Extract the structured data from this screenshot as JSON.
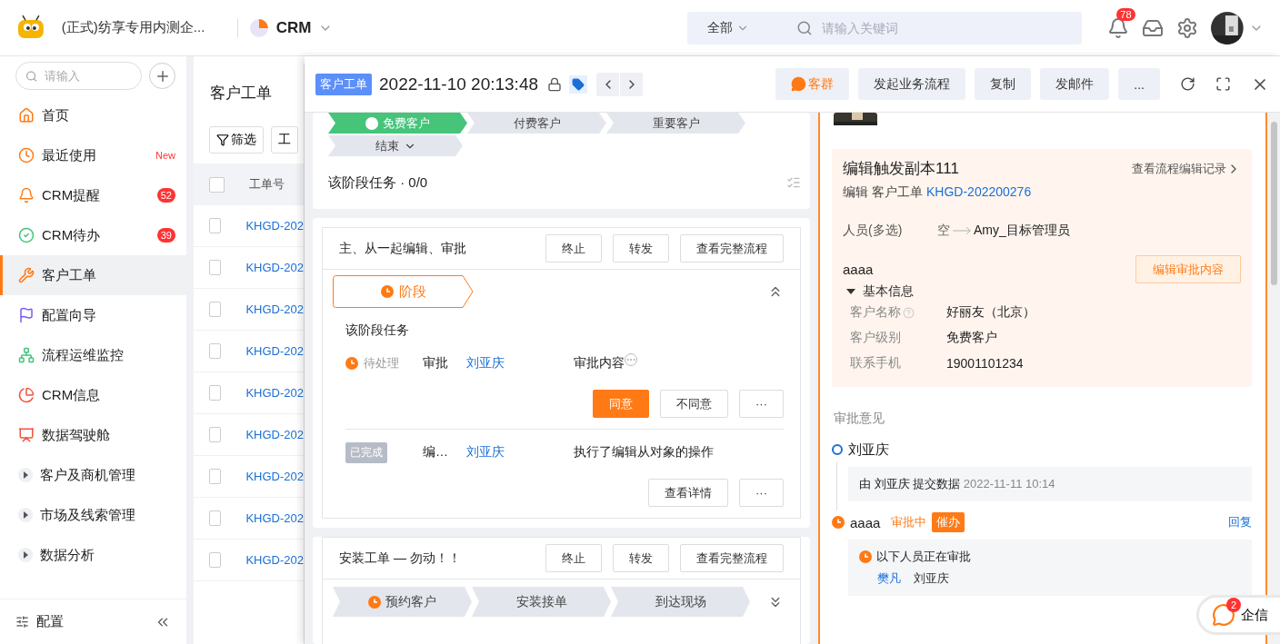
{
  "topbar": {
    "org": "(正式)纺享专用内测企...",
    "app": "CRM",
    "search_scope": "全部",
    "search_placeholder": "请输入关键词",
    "notification_count": "78"
  },
  "sidebar": {
    "search_placeholder": "请输入",
    "items": [
      {
        "label": "首页",
        "kind": "link",
        "selected": false
      },
      {
        "label": "最近使用",
        "kind": "link",
        "selected": false,
        "badge": "New",
        "badge_pill": false
      },
      {
        "label": "CRM提醒",
        "kind": "link",
        "selected": false,
        "badge": "52",
        "badge_pill": true
      },
      {
        "label": "CRM待办",
        "kind": "link",
        "selected": false,
        "badge": "39",
        "badge_pill": true
      },
      {
        "label": "客户工单",
        "kind": "link",
        "selected": true
      },
      {
        "label": "配置向导",
        "kind": "link",
        "selected": false
      },
      {
        "label": "流程运维监控",
        "kind": "link",
        "selected": false
      },
      {
        "label": "CRM信息",
        "kind": "link",
        "selected": false
      },
      {
        "label": "数据驾驶舱",
        "kind": "link",
        "selected": false
      },
      {
        "label": "客户及商机管理",
        "kind": "group",
        "selected": false
      },
      {
        "label": "市场及线索管理",
        "kind": "group",
        "selected": false
      },
      {
        "label": "数据分析",
        "kind": "group",
        "selected": false
      }
    ],
    "footer": "配置"
  },
  "list": {
    "title": "客户工单",
    "filter": "筛选",
    "button_2": "工",
    "column": "工单号",
    "all_checked": false,
    "rows": [
      {
        "number": "KHGD-202",
        "checked": false
      },
      {
        "number": "KHGD-202",
        "checked": false
      },
      {
        "number": "KHGD-202",
        "checked": false
      },
      {
        "number": "KHGD-202",
        "checked": false
      },
      {
        "number": "KHGD-202",
        "checked": false
      },
      {
        "number": "KHGD-202",
        "checked": false
      },
      {
        "number": "KHGD-202",
        "checked": false
      },
      {
        "number": "KHGD-202",
        "checked": false
      },
      {
        "number": "KHGD-202",
        "checked": false
      }
    ]
  },
  "drawer": {
    "tag": "客户工单",
    "title": "2022-11-10 20:13:48",
    "actions": [
      {
        "label": "客群",
        "kind": "chat"
      },
      {
        "label": "发起业务流程",
        "kind": "plain"
      },
      {
        "label": "复制",
        "kind": "plain"
      },
      {
        "label": "发邮件",
        "kind": "plain"
      },
      {
        "label": "...",
        "kind": "plain"
      }
    ]
  },
  "stage_card": {
    "stages": [
      {
        "label": "免费客户",
        "selected": true
      },
      {
        "label": "付费客户",
        "selected": false
      },
      {
        "label": "重要客户",
        "selected": false
      },
      {
        "label": "结束",
        "selected": false,
        "dropdown": true
      }
    ],
    "task_summary": "该阶段任务 · 0/0"
  },
  "approval_flow": {
    "title": "主、从一起编辑、审批",
    "buttons": [
      "终止",
      "转发",
      "查看完整流程"
    ],
    "stage": "阶段",
    "expanded": true,
    "tasks_title": "该阶段任务",
    "tasks": [
      {
        "kind": "pending",
        "status": "待处理",
        "type": "审批",
        "person": "刘亚庆",
        "content": "审批内容",
        "actions": [
          {
            "label": "同意",
            "primary": true
          },
          {
            "label": "不同意",
            "primary": false
          },
          {
            "label": "···",
            "primary": false
          }
        ]
      },
      {
        "kind": "done",
        "status": "已完成",
        "type": "编…",
        "person": "刘亚庆",
        "content": "执行了编辑从对象的操作",
        "actions": [
          {
            "label": "查看详情",
            "primary": false
          },
          {
            "label": "···",
            "primary": false
          }
        ]
      }
    ]
  },
  "install_flow": {
    "title": "安装工单 — 勿动！！",
    "buttons": [
      "终止",
      "转发",
      "查看完整流程"
    ],
    "expanded": false,
    "stages": [
      {
        "label": "预约客户",
        "selected": true
      },
      {
        "label": "安装接单",
        "selected": false
      },
      {
        "label": "到达现场",
        "selected": false
      }
    ]
  },
  "record": {
    "title": "编辑触发副本111",
    "history_link": "查看流程编辑记录",
    "verb": "编辑",
    "object": "客户工单",
    "object_link": "KHGD-202200276",
    "change": {
      "field": "人员(多选)",
      "from": "空",
      "to": "Amy_目标管理员"
    },
    "form_title": "aaaa",
    "edit_button": "编辑审批内容",
    "section": "基本信息",
    "section_expanded": true,
    "fields": [
      {
        "label": "客户名称",
        "value": "好丽友（北京）",
        "help": true
      },
      {
        "label": "客户级别",
        "value": "免费客户",
        "help": false
      },
      {
        "label": "联系手机",
        "value": "19001101234",
        "help": false
      }
    ]
  },
  "opinions": {
    "heading": "审批意见",
    "nodes": [
      {
        "kind": "submitted",
        "name": "刘亚庆",
        "by": "由 刘亚庆 提交数据",
        "time": "2022-11-11 10:14"
      },
      {
        "kind": "in_progress",
        "name": "aaaa",
        "status": "审批中",
        "urge": "催办",
        "reply": "回复",
        "pending_label": "以下人员正在审批",
        "approvers": [
          {
            "name": "樊凡",
            "link": true
          },
          {
            "name": "刘亚庆",
            "link": false
          }
        ]
      }
    ]
  },
  "chat": {
    "label": "企信",
    "count": "2"
  }
}
